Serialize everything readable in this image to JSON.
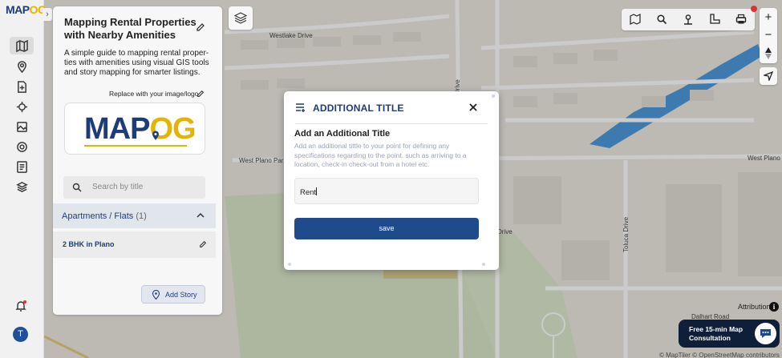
{
  "brand": {
    "logo_map": "MAP",
    "logo_og": "OG"
  },
  "panel": {
    "title": "Mapping Rental Properties with Nearby Amenities",
    "description": "A simple guide to mapping rental proper-ties with amenities using visual GIS tools and story mapping for smarter listings.",
    "replace_label": "Replace with your image/logo",
    "search_placeholder": "Search by title",
    "group": {
      "label": "Apartments / Flats",
      "count": "(1)"
    },
    "items": [
      {
        "label": "2 BHK in Plano"
      }
    ],
    "add_story_label": "Add Story"
  },
  "user": {
    "initial": "T"
  },
  "map": {
    "streets": {
      "westlake": "Westlake Drive",
      "plano_park": "West Plano Park",
      "plano_pkwy": "West Plano Pkwy",
      "toluca": "Toluca Drive",
      "dalhart": "Dalhart Road",
      "drive_left": "Drive",
      "drive_mid": "Drive",
      "drive_low": "Drive"
    },
    "attribution_label": "Attribution",
    "copyright": "© MapTiler © OpenStreetMap contributors"
  },
  "consult": {
    "label": "Free 15-min Map Consultation"
  },
  "modal": {
    "title": "ADDITIONAL TITLE",
    "subtitle": "Add an Additional Title",
    "help": "Add an additional tittle to your point for defining any specifications regarding to the point. such as arriving to a location, check-in check-out from a hotel etc.",
    "input_value": "Rent",
    "save_label": "save"
  },
  "colors": {
    "brand_blue": "#1f3c7a",
    "brand_gold": "#e6b400",
    "save_blue": "#1f4a8c",
    "water": "#3b8fd9"
  }
}
